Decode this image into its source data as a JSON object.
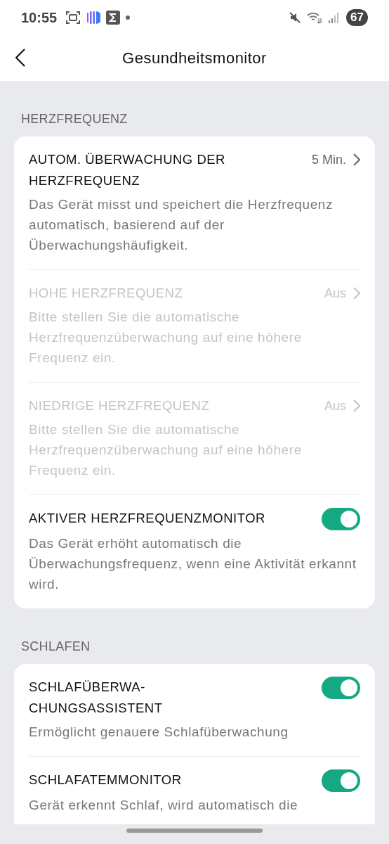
{
  "status_bar": {
    "time": "10:55",
    "battery": "67"
  },
  "header": {
    "title": "Gesundheitsmonitor"
  },
  "sections": [
    {
      "label": "HERZFREQUENZ",
      "items": [
        {
          "kind": "value",
          "title": "AUTOM. ÜBERWACHUNG DER HERZFREQUENZ",
          "value": "5 Min.",
          "disabled": false,
          "description": "Das Gerät misst und speichert die Herzfrequenz automatisch, basierend auf der Überwachungshäufigkeit."
        },
        {
          "kind": "value",
          "title": "HOHE HERZFREQUENZ",
          "value": "Aus",
          "disabled": true,
          "description": "Bitte stellen Sie die automatische Herzfrequenzüberwachung auf eine höhere Frequenz ein."
        },
        {
          "kind": "value",
          "title": "NIEDRIGE HERZFREQUENZ",
          "value": "Aus",
          "disabled": true,
          "description": "Bitte stellen Sie die automatische Herzfrequenzüberwachung auf eine höhere Frequenz ein."
        },
        {
          "kind": "toggle",
          "title": "AKTIVER HERZFREQUENZMONITOR",
          "on": true,
          "description": "Das Gerät erhöht automatisch die Überwachungsfrequenz, wenn eine Aktivität erkannt wird."
        }
      ]
    },
    {
      "label": "SCHLAFEN",
      "items": [
        {
          "kind": "toggle",
          "title": "SCHLAFÜBERWA-CHUNGSASSISTENT",
          "on": true,
          "description": "Ermöglicht genauere Schlafüberwachung"
        },
        {
          "kind": "toggle",
          "title": "SCHLAFATEMMONITOR",
          "on": true,
          "description": "Gerät erkennt Schlaf, wird automatisch die"
        }
      ]
    }
  ]
}
